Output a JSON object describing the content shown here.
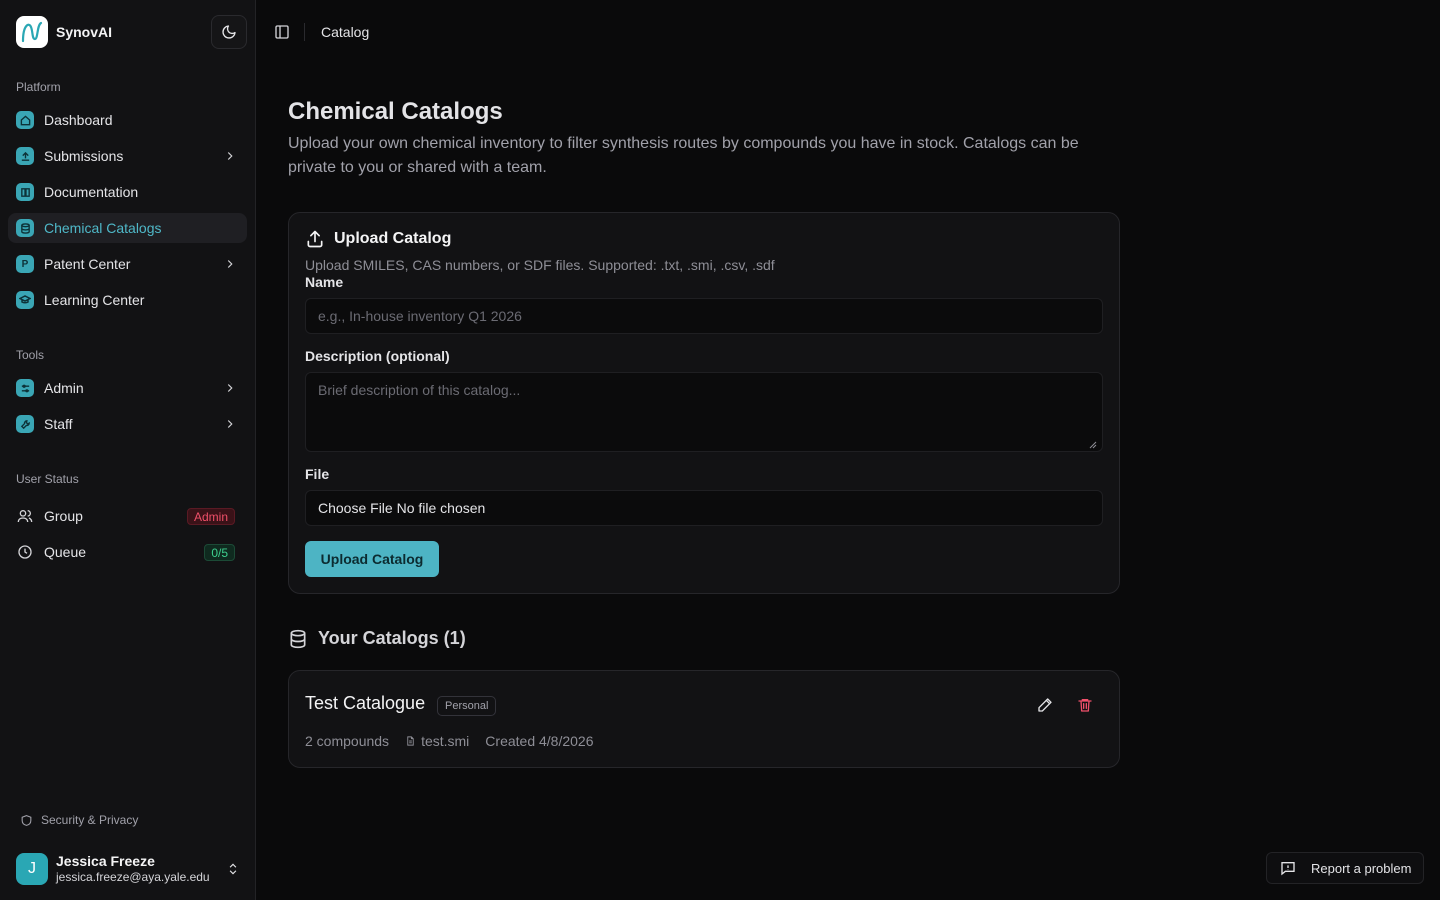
{
  "app": {
    "name": "SynovAI"
  },
  "sidebar": {
    "platform_label": "Platform",
    "platform_items": [
      {
        "label": "Dashboard",
        "icon": "home-icon"
      },
      {
        "label": "Submissions",
        "icon": "upload-icon"
      },
      {
        "label": "Documentation",
        "icon": "book-icon"
      },
      {
        "label": "Chemical Catalogs",
        "icon": "database-icon"
      },
      {
        "label": "Patent Center",
        "icon": "P"
      },
      {
        "label": "Learning Center",
        "icon": "graduation-cap-icon"
      }
    ],
    "tools_label": "Tools",
    "tools_items": [
      {
        "label": "Admin",
        "icon": "sliders-icon"
      },
      {
        "label": "Staff",
        "icon": "wrench-icon"
      }
    ],
    "status_label": "User Status",
    "group": {
      "label": "Group",
      "badge": "Admin"
    },
    "queue": {
      "label": "Queue",
      "badge": "0/5"
    },
    "security_label": "Security & Privacy",
    "user": {
      "initial": "J",
      "name": "Jessica Freeze",
      "email": "jessica.freeze@aya.yale.edu"
    }
  },
  "topbar": {
    "breadcrumb": "Catalog"
  },
  "page": {
    "title": "Chemical Catalogs",
    "description": "Upload your own chemical inventory to filter synthesis routes by compounds you have in stock. Catalogs can be private to you or shared with a team."
  },
  "upload": {
    "title": "Upload Catalog",
    "subtitle": "Upload SMILES, CAS numbers, or SDF files. Supported: .txt, .smi, .csv, .sdf",
    "name_label": "Name",
    "name_placeholder": "e.g., In-house inventory Q1 2026",
    "desc_label": "Description (optional)",
    "desc_placeholder": "Brief description of this catalog...",
    "file_label": "File",
    "file_value": "Choose File No file chosen",
    "button": "Upload Catalog"
  },
  "catalogs": {
    "heading": "Your Catalogs (1)",
    "items": [
      {
        "name": "Test Catalogue",
        "badge": "Personal",
        "compounds": "2 compounds",
        "file": "test.smi",
        "created": "Created 4/8/2026"
      }
    ]
  },
  "report": {
    "label": "Report a problem"
  },
  "colors": {
    "accent": "#4db4c4",
    "danger": "#f0506a",
    "success": "#3ecf8e"
  }
}
